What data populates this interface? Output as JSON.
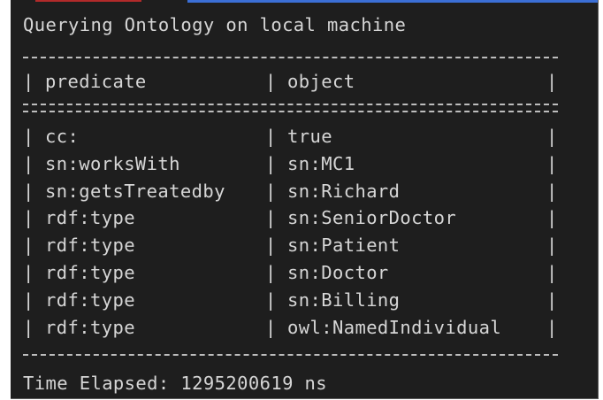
{
  "terminal": {
    "header": "Querying Ontology on local machine",
    "bar_char": "|",
    "columns": [
      "predicate",
      "object"
    ],
    "rows": [
      {
        "predicate": "cc:",
        "object": "true"
      },
      {
        "predicate": "sn:worksWith",
        "object": "sn:MC1"
      },
      {
        "predicate": "sn:getsTreatedby",
        "object": "sn:Richard"
      },
      {
        "predicate": "rdf:type",
        "object": "sn:SeniorDoctor"
      },
      {
        "predicate": "rdf:type",
        "object": "sn:Patient"
      },
      {
        "predicate": "rdf:type",
        "object": "sn:Doctor"
      },
      {
        "predicate": "rdf:type",
        "object": "sn:Billing"
      },
      {
        "predicate": "rdf:type",
        "object": "owl:NamedIndividual"
      }
    ],
    "footer": "Time Elapsed: 1295200619 ns"
  },
  "colors": {
    "background": "#1e1e1e",
    "text": "#d6d6d6",
    "rule": "#bdbdbd"
  }
}
